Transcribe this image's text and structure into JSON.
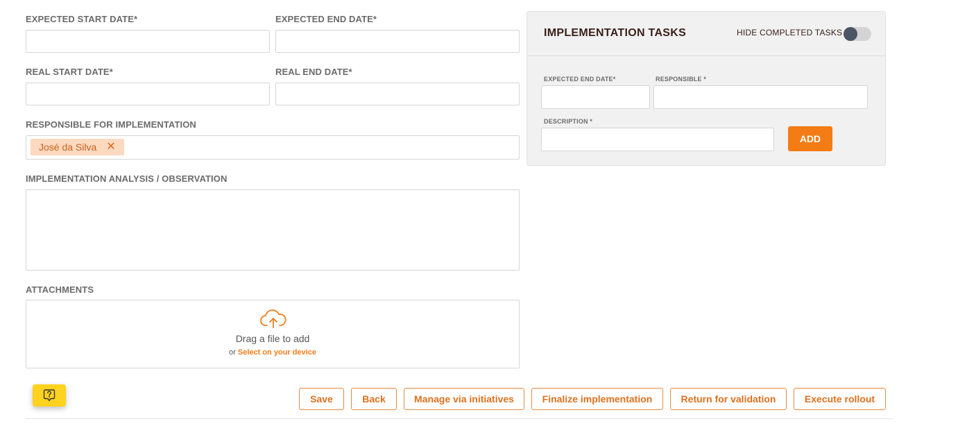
{
  "form": {
    "expected_start_label": "EXPECTED START DATE*",
    "expected_end_label": "EXPECTED END DATE*",
    "real_start_label": "REAL START DATE*",
    "real_end_label": "REAL END DATE*",
    "responsible_label": "RESPONSIBLE FOR IMPLEMENTATION",
    "responsible_chip": "José da Silva",
    "analysis_label": "IMPLEMENTATION ANALYSIS / OBSERVATION",
    "attachments_label": "ATTACHMENTS",
    "drag_text": "Drag a file to add",
    "or_text": "or",
    "select_link": "Select on your device"
  },
  "tasks_panel": {
    "title": "IMPLEMENTATION TASKS",
    "hide_completed_label": "HIDE COMPLETED TASKS",
    "hide_completed_on": false,
    "expected_end_label": "EXPECTED END DATE*",
    "responsible_label": "RESPONSIBLE *",
    "description_label": "DESCRIPTION *",
    "add_button": "ADD"
  },
  "actions": {
    "save": "Save",
    "back": "Back",
    "manage": "Manage via initiatives",
    "finalize": "Finalize implementation",
    "return": "Return for validation",
    "execute": "Execute rollout"
  },
  "colors": {
    "accent": "#f47c14",
    "help_button": "#ffd21f"
  },
  "icons": {
    "upload": "cloud-upload-icon",
    "remove_chip": "close-icon",
    "help": "help-icon"
  }
}
